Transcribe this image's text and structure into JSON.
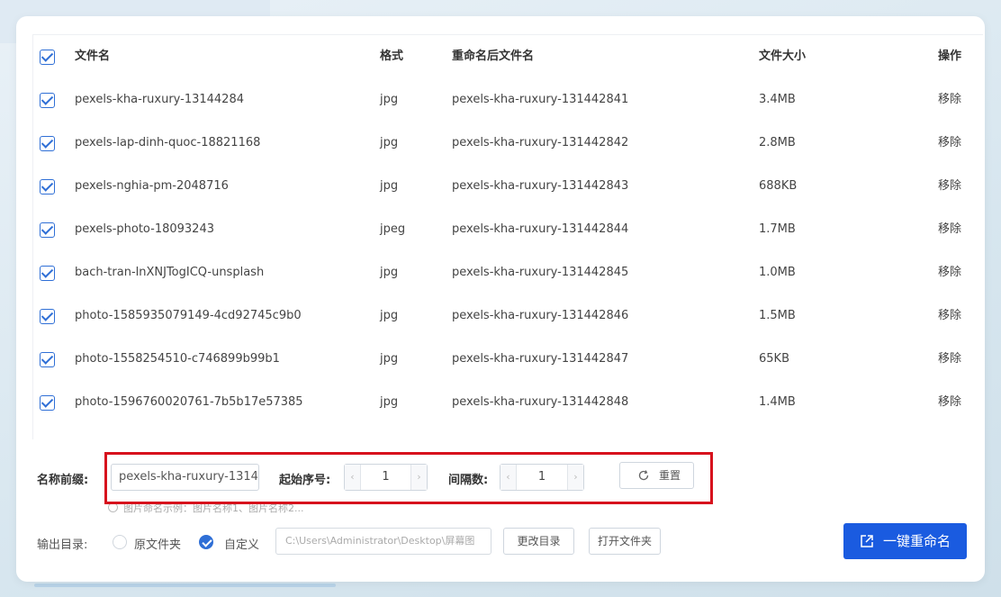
{
  "table": {
    "headers": {
      "filename": "文件名",
      "format": "格式",
      "new_name": "重命名后文件名",
      "size": "文件大小",
      "action": "操作"
    },
    "rows": [
      {
        "name": "pexels-kha-ruxury-13144284",
        "format": "jpg",
        "new_name": "pexels-kha-ruxury-131442841",
        "size": "3.4MB",
        "action": "移除"
      },
      {
        "name": "pexels-lap-dinh-quoc-18821168",
        "format": "jpg",
        "new_name": "pexels-kha-ruxury-131442842",
        "size": "2.8MB",
        "action": "移除"
      },
      {
        "name": "pexels-nghia-pm-2048716",
        "format": "jpg",
        "new_name": "pexels-kha-ruxury-131442843",
        "size": "688KB",
        "action": "移除"
      },
      {
        "name": "pexels-photo-18093243",
        "format": "jpeg",
        "new_name": "pexels-kha-ruxury-131442844",
        "size": "1.7MB",
        "action": "移除"
      },
      {
        "name": "bach-tran-lnXNJTogICQ-unsplash",
        "format": "jpg",
        "new_name": "pexels-kha-ruxury-131442845",
        "size": "1.0MB",
        "action": "移除"
      },
      {
        "name": "photo-1585935079149-4cd92745c9b0",
        "format": "jpg",
        "new_name": "pexels-kha-ruxury-131442846",
        "size": "1.5MB",
        "action": "移除"
      },
      {
        "name": "photo-1558254510-c746899b99b1",
        "format": "jpg",
        "new_name": "pexels-kha-ruxury-131442847",
        "size": "65KB",
        "action": "移除"
      },
      {
        "name": "photo-1596760020761-7b5b17e57385",
        "format": "jpg",
        "new_name": "pexels-kha-ruxury-131442848",
        "size": "1.4MB",
        "action": "移除"
      }
    ]
  },
  "rename": {
    "prefix_label": "名称前缀:",
    "prefix_value": "pexels-kha-ruxury-1314",
    "start_label": "起始序号:",
    "start_value": "1",
    "step_label": "间隔数:",
    "step_value": "1",
    "reset_label": "重置",
    "hint": "图片命名示例：图片名称1、图片名称2..."
  },
  "output": {
    "label": "输出目录:",
    "option_original": "原文件夹",
    "option_custom": "自定义",
    "selected": "custom",
    "path": "C:\\Users\\Administrator\\Desktop\\屏幕图",
    "change_dir_label": "更改目录",
    "open_folder_label": "打开文件夹",
    "rename_all_label": "一键重命名"
  },
  "colors": {
    "accent": "#2f6fd6",
    "primary_button": "#1a5be0",
    "highlight_box": "#d7121d"
  }
}
